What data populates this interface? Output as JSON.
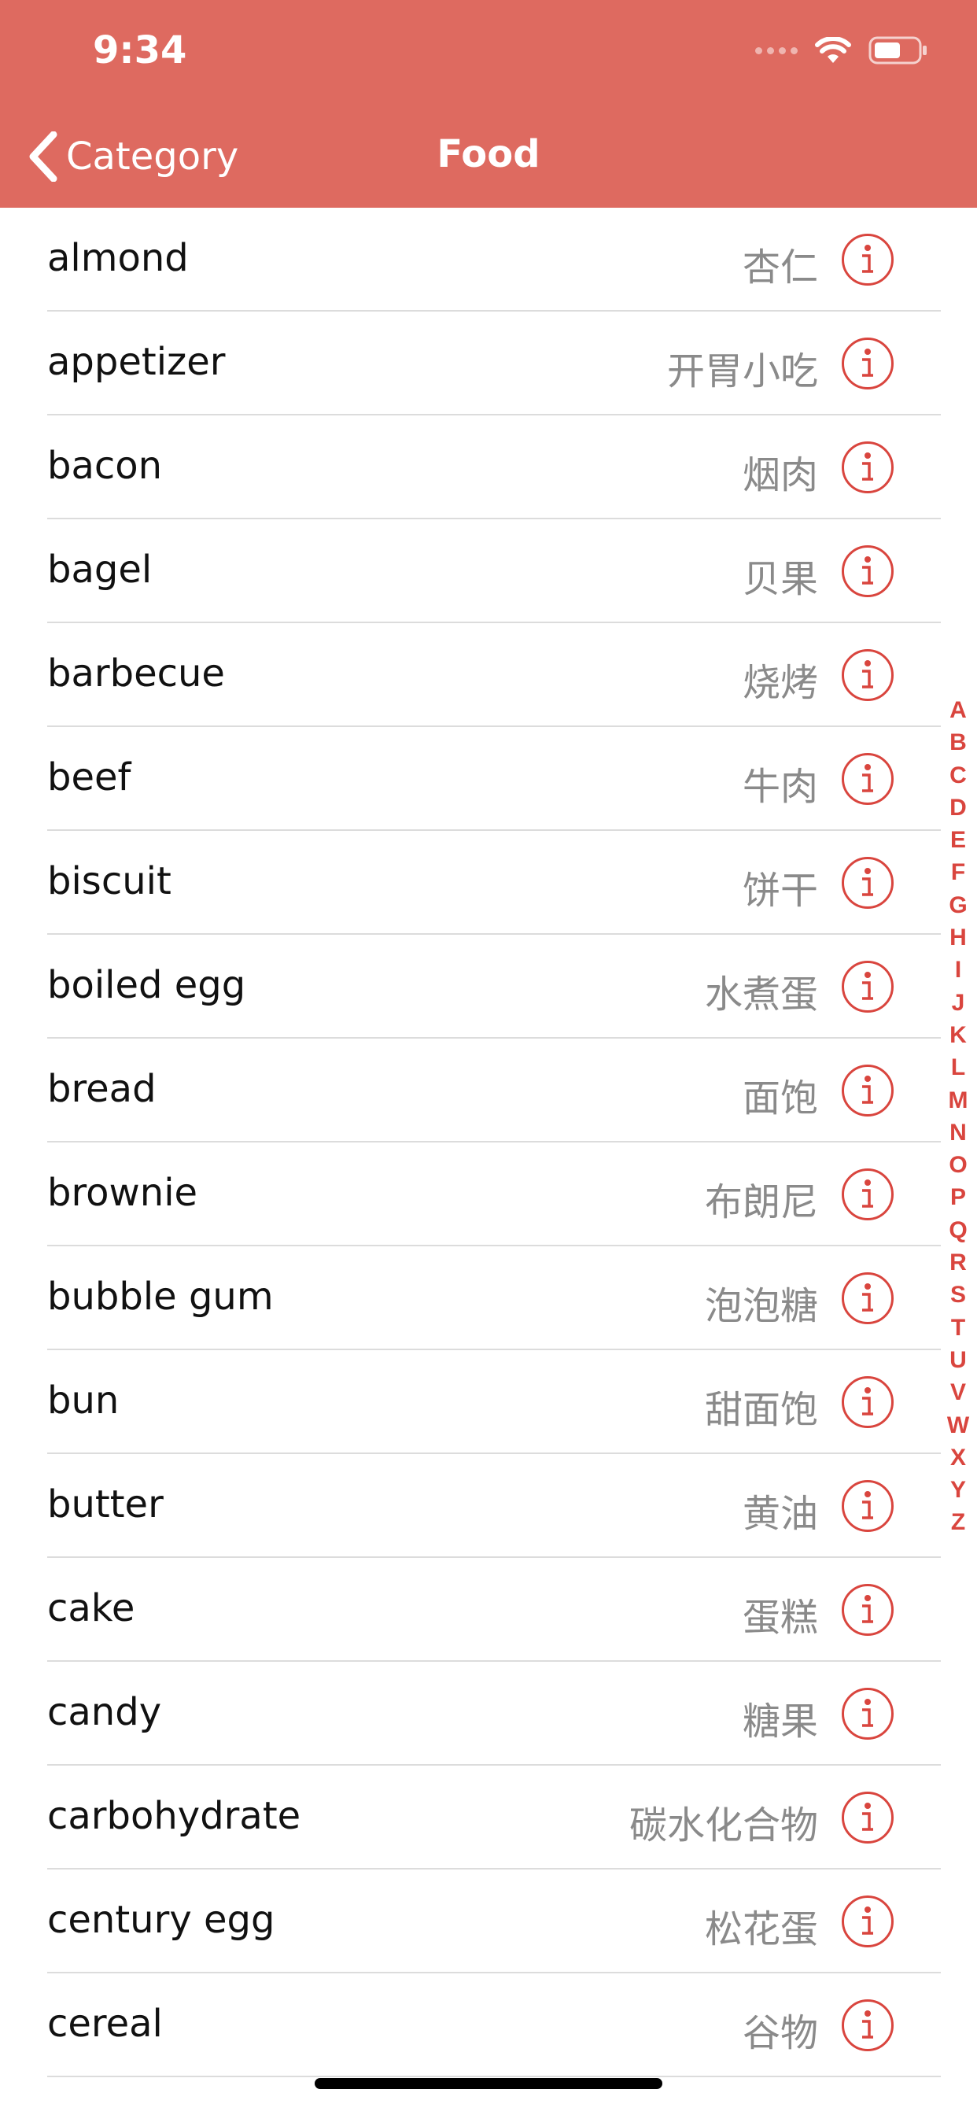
{
  "status_bar": {
    "time": "9:34",
    "icons": [
      "cellular-dots-icon",
      "wifi-icon",
      "battery-icon"
    ]
  },
  "nav": {
    "back_label": "Category",
    "title": "Food"
  },
  "colors": {
    "header_background": "#de6a60",
    "accent": "#d9453e",
    "translation_text": "#8a8a8a",
    "separator": "#dcdcdc"
  },
  "list": {
    "items": [
      {
        "word": "almond",
        "translation": "杏仁"
      },
      {
        "word": "appetizer",
        "translation": "开胃小吃"
      },
      {
        "word": "bacon",
        "translation": "烟肉"
      },
      {
        "word": "bagel",
        "translation": "贝果"
      },
      {
        "word": "barbecue",
        "translation": "烧烤"
      },
      {
        "word": "beef",
        "translation": "牛肉"
      },
      {
        "word": "biscuit",
        "translation": "饼干"
      },
      {
        "word": "boiled egg",
        "translation": "水煮蛋"
      },
      {
        "word": "bread",
        "translation": "面饱"
      },
      {
        "word": "brownie",
        "translation": "布朗尼"
      },
      {
        "word": "bubble gum",
        "translation": "泡泡糖"
      },
      {
        "word": "bun",
        "translation": "甜面饱"
      },
      {
        "word": "butter",
        "translation": "黄油"
      },
      {
        "word": "cake",
        "translation": "蛋糕"
      },
      {
        "word": "candy",
        "translation": "糖果"
      },
      {
        "word": "carbohydrate",
        "translation": "碳水化合物"
      },
      {
        "word": "century egg",
        "translation": "松花蛋"
      },
      {
        "word": "cereal",
        "translation": "谷物"
      }
    ],
    "row_icon": "info-icon"
  },
  "index": {
    "letters": [
      "A",
      "B",
      "C",
      "D",
      "E",
      "F",
      "G",
      "H",
      "I",
      "J",
      "K",
      "L",
      "M",
      "N",
      "O",
      "P",
      "Q",
      "R",
      "S",
      "T",
      "U",
      "V",
      "W",
      "X",
      "Y",
      "Z"
    ]
  }
}
